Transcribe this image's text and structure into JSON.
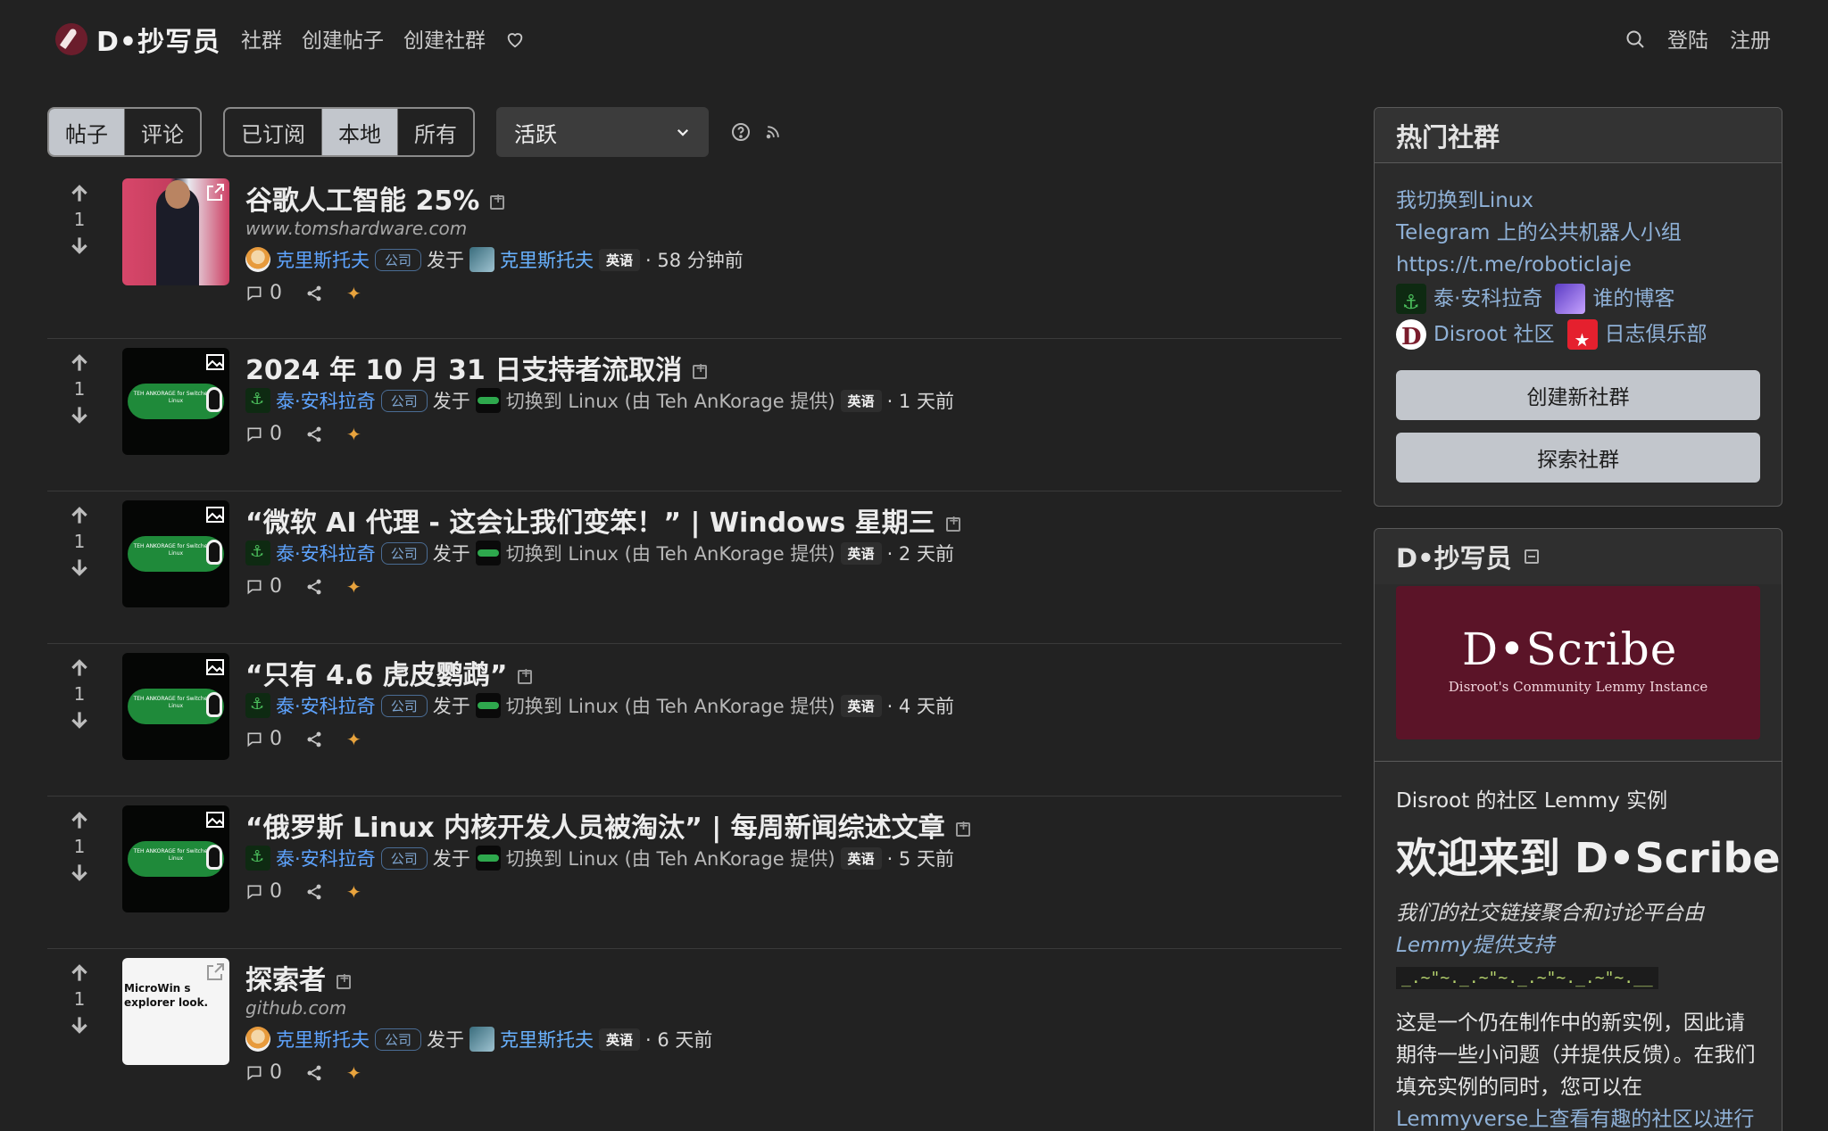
{
  "nav": {
    "brand": "D•抄写员",
    "links": [
      "社群",
      "创建帖子",
      "创建社群"
    ],
    "login": "登陆",
    "register": "注册"
  },
  "toolbar": {
    "type_tabs": [
      "帖子",
      "评论"
    ],
    "listing_tabs": [
      "已订阅",
      "本地",
      "所有"
    ],
    "sort_value": "活跃"
  },
  "posts": [
    {
      "title": "谷歌人工智能 25%",
      "domain": "www.tomshardware.com",
      "author": "克里斯托夫",
      "badge": "公司",
      "posted_in": "发于",
      "community": "克里斯托夫",
      "lang": "英语",
      "time": "· 58 分钟前",
      "score": "1",
      "comments": "0"
    },
    {
      "title": "2024 年 10 月 31 日支持者流取消",
      "author": "泰·安科拉奇",
      "badge": "公司",
      "posted_in": "发于",
      "community": "切换到 Linux (由 Teh AnKorage 提供)",
      "lang": "英语",
      "time": "· 1 天前",
      "score": "1",
      "comments": "0"
    },
    {
      "title": "“微软 AI 代理 - 这会让我们变笨！” | Windows 星期三",
      "author": "泰·安科拉奇",
      "badge": "公司",
      "posted_in": "发于",
      "community": "切换到 Linux (由 Teh AnKorage 提供)",
      "lang": "英语",
      "time": "· 2 天前",
      "score": "1",
      "comments": "0"
    },
    {
      "title": "“只有 4.6 虎皮鹦鹉”",
      "author": "泰·安科拉奇",
      "badge": "公司",
      "posted_in": "发于",
      "community": "切换到 Linux (由 Teh AnKorage 提供)",
      "lang": "英语",
      "time": "· 4 天前",
      "score": "1",
      "comments": "0"
    },
    {
      "title": "“俄罗斯 Linux 内核开发人员被淘汰” | 每周新闻综述文章",
      "author": "泰·安科拉奇",
      "badge": "公司",
      "posted_in": "发于",
      "community": "切换到 Linux (由 Teh AnKorage 提供)",
      "lang": "英语",
      "time": "· 5 天前",
      "score": "1",
      "comments": "0"
    },
    {
      "title": "探索者",
      "domain": "github.com",
      "author": "克里斯托夫",
      "badge": "公司",
      "posted_in": "发于",
      "community": "克里斯托夫",
      "lang": "英语",
      "time": "· 6 天前",
      "score": "1",
      "comments": "0"
    }
  ],
  "thumbnails": {
    "linux_pill": "TEH ANKORAGE for Switched To Linux",
    "doc_text": "MicroWin s explorer look."
  },
  "trending": {
    "header": "热门社群",
    "links": [
      "我切换到Linux",
      "Telegram 上的公共机器人小组",
      "https://t.me/roboticlaje"
    ],
    "row1": [
      "泰·安科拉奇",
      "谁的博客"
    ],
    "row2": [
      "Disroot 社区",
      "日志俱乐部"
    ],
    "create_button": "创建新社群",
    "explore_button": "探索社群"
  },
  "site": {
    "header": "D•抄写员",
    "banner_logo": "D•Scribe",
    "banner_sub": "Disroot's Community Lemmy Instance",
    "tagline": "Disroot 的社区 Lemmy 实例",
    "title": "欢迎来到 D•Scribe",
    "italic_a": "我们的社交链接聚合和讨论平台由",
    "italic_b": "Lemmy提供支持",
    "tilde": "_.~\"~._.~\"~._.~\"~._.~\"~.__",
    "text_a": "这是一个仍在制作中的新实例，因此请期待一些小问题（并提供反馈）。在我们填充实例的同时，您可以在",
    "text_link": "Lemmyverse上查看有趣的社区以进行"
  },
  "colors": {
    "background": "#222222",
    "link": "#5ea4ff",
    "active_tab": "#c2c6cc",
    "banner": "#5b1428"
  }
}
